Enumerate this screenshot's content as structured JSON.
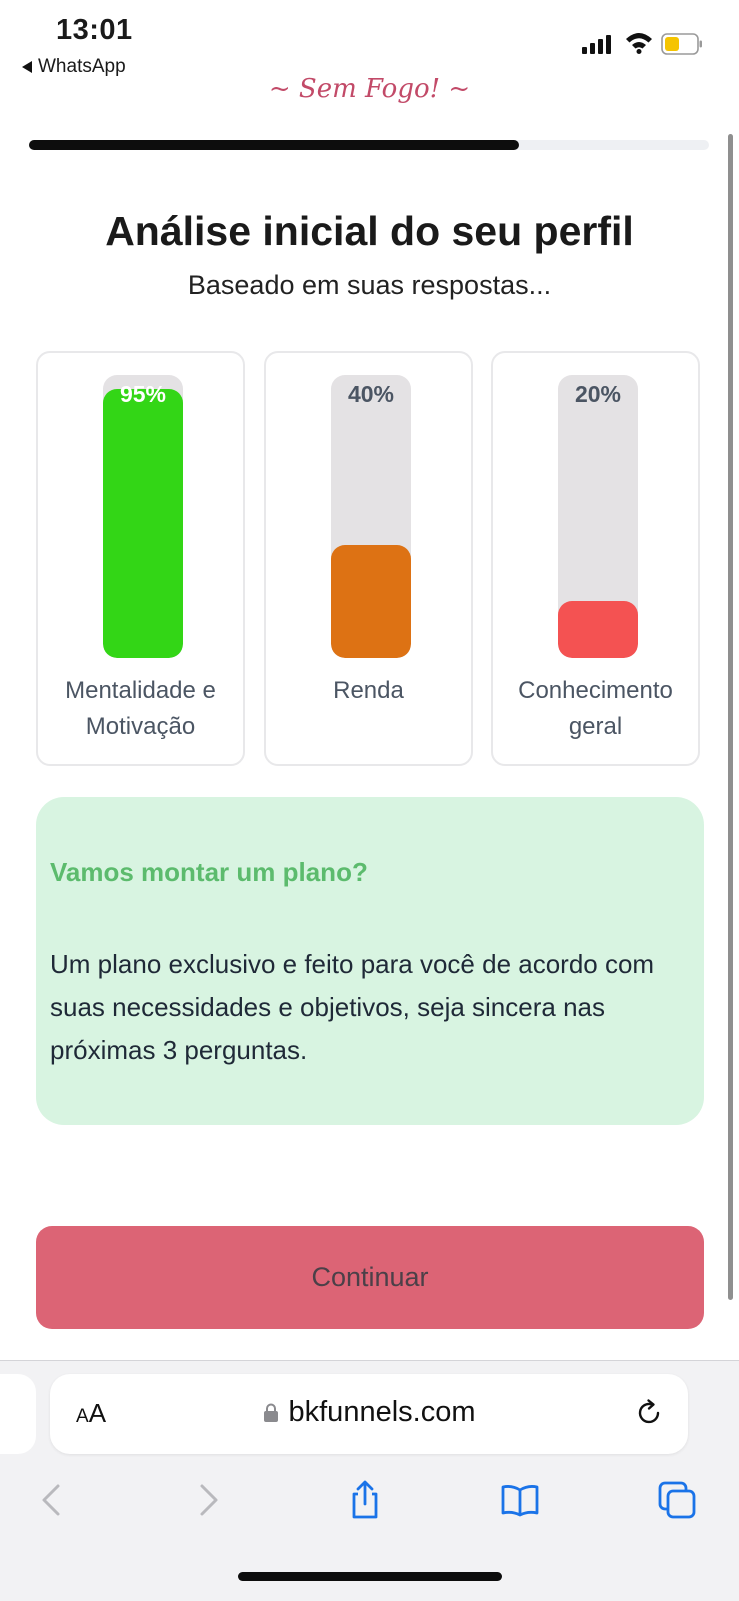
{
  "status_bar": {
    "time": "13:01",
    "back_app": "WhatsApp"
  },
  "brand": {
    "text": "~ Sem Fogo! ~",
    "color": "#c24a68"
  },
  "progress": {
    "fraction": 0.72
  },
  "header": {
    "title": "Análise inicial do seu perfil",
    "subtitle": "Baseado em suas respostas..."
  },
  "metrics": [
    {
      "percent_label": "95%",
      "value": 95,
      "label": "Mentalidade e Motivação",
      "color": "#33d616"
    },
    {
      "percent_label": "40%",
      "value": 40,
      "label": "Renda",
      "color": "#dd7214"
    },
    {
      "percent_label": "20%",
      "value": 20,
      "label": "Conhecimento geral",
      "color": "#f45252"
    }
  ],
  "info": {
    "title": "Vamos montar um plano?",
    "text": "Um plano exclusivo e feito para você de acordo com suas necessidades e objetivos, seja sincera nas próximas 3 perguntas."
  },
  "actions": {
    "continue_label": "Continuar"
  },
  "browser": {
    "text_size_label_small": "A",
    "text_size_label_large": "A",
    "url": "bkfunnels.com",
    "icons": [
      "back-icon",
      "forward-icon",
      "share-icon",
      "bookmarks-icon",
      "tabs-icon",
      "lock-icon",
      "reload-icon"
    ]
  }
}
